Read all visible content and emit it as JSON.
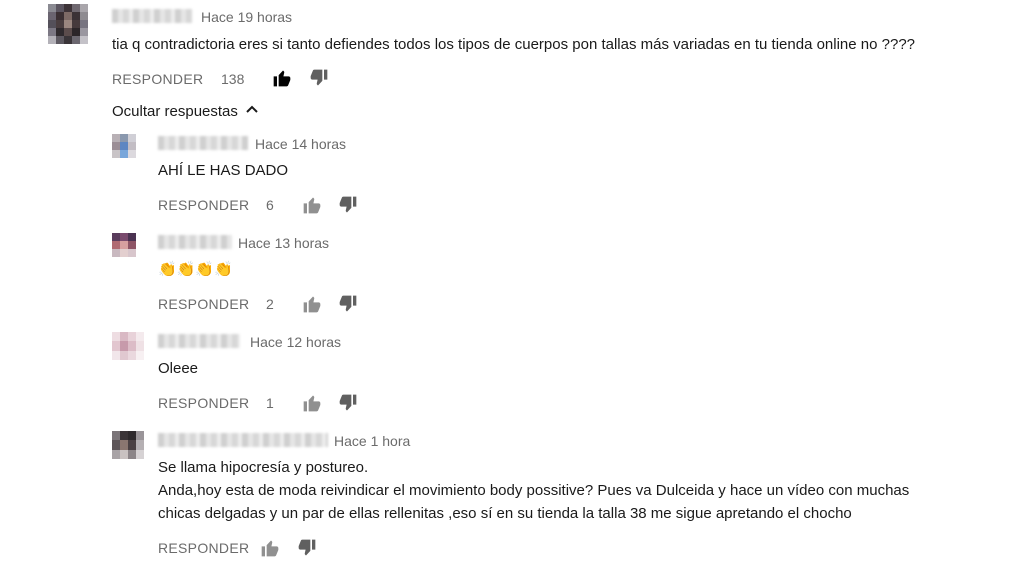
{
  "top_comment": {
    "time": "Hace 19 horas",
    "text": "tia q contradictoria eres si tanto defiendes todos los tipos de cuerpos pon tallas más variadas en tu tienda online no ????",
    "reply_label": "RESPONDER",
    "likes": "138"
  },
  "hide_replies_label": "Ocultar respuestas",
  "replies": [
    {
      "time": "Hace 14 horas",
      "text": "AHÍ LE HAS DADO",
      "reply_label": "RESPONDER",
      "likes": "6"
    },
    {
      "time": "Hace 13 horas",
      "text": "👏👏👏👏",
      "reply_label": "RESPONDER",
      "likes": "2"
    },
    {
      "time": "Hace 12 horas",
      "text": "Oleee",
      "reply_label": "RESPONDER",
      "likes": "1"
    },
    {
      "time": "Hace 1 hora",
      "text_lines": [
        "Se llama hipocresía y postureo.",
        "Anda,hoy esta de moda reivindicar el movimiento body possitive? Pues va Dulceida y hace un vídeo con muchas",
        "chicas delgadas y un par de ellas rellenitas ,eso sí en su tienda la talla 38 me sigue apretando el chocho"
      ],
      "reply_label": "RESPONDER",
      "likes": ""
    }
  ]
}
